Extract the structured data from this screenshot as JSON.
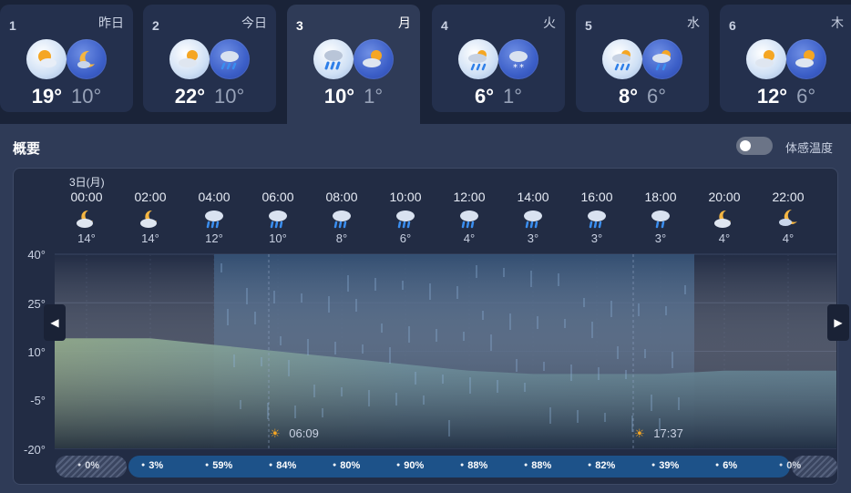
{
  "days": [
    {
      "num": "1",
      "dow": "昨日",
      "hi": "19°",
      "lo": "10°",
      "day_icon": "partly-sunny-icon",
      "night_icon": "partly-cloudy-night-icon"
    },
    {
      "num": "2",
      "dow": "今日",
      "hi": "22°",
      "lo": "10°",
      "day_icon": "partly-cloudy-icon",
      "night_icon": "rain-showers-icon"
    },
    {
      "num": "3",
      "dow": "月",
      "hi": "10°",
      "lo": "1°",
      "day_icon": "heavy-rain-icon",
      "night_icon": "partly-cloudy-icon",
      "selected": true
    },
    {
      "num": "4",
      "dow": "火",
      "hi": "6°",
      "lo": "1°",
      "day_icon": "rain-icon",
      "night_icon": "snow-icon"
    },
    {
      "num": "5",
      "dow": "水",
      "hi": "8°",
      "lo": "6°",
      "day_icon": "rain-icon",
      "night_icon": "rain-showers-icon"
    },
    {
      "num": "6",
      "dow": "木",
      "hi": "12°",
      "lo": "6°",
      "day_icon": "partly-cloudy-icon",
      "night_icon": "partly-cloudy-icon"
    }
  ],
  "overview": {
    "title": "概要",
    "toggle_label": "体感温度"
  },
  "date_label": "3日(月)",
  "hours": [
    {
      "time": "00:00",
      "temp": "14°",
      "icon": "partly-cloudy-night-icon"
    },
    {
      "time": "02:00",
      "temp": "14°",
      "icon": "partly-cloudy-night-icon"
    },
    {
      "time": "04:00",
      "temp": "12°",
      "icon": "rain-icon"
    },
    {
      "time": "06:00",
      "temp": "10°",
      "icon": "rain-icon"
    },
    {
      "time": "08:00",
      "temp": "8°",
      "icon": "rain-icon"
    },
    {
      "time": "10:00",
      "temp": "6°",
      "icon": "rain-icon"
    },
    {
      "time": "12:00",
      "temp": "4°",
      "icon": "rain-icon"
    },
    {
      "time": "14:00",
      "temp": "3°",
      "icon": "rain-icon"
    },
    {
      "time": "16:00",
      "temp": "3°",
      "icon": "rain-icon"
    },
    {
      "time": "18:00",
      "temp": "3°",
      "icon": "rain-showers-icon"
    },
    {
      "time": "20:00",
      "temp": "4°",
      "icon": "partly-cloudy-night-icon"
    },
    {
      "time": "22:00",
      "temp": "4°",
      "icon": "moon-cloud-icon"
    }
  ],
  "y_axis": [
    "40°",
    "25°",
    "10°",
    "-5°",
    "-20°"
  ],
  "sunrise": "06:09",
  "sunset": "17:37",
  "precip": [
    "0%",
    "3%",
    "59%",
    "84%",
    "80%",
    "90%",
    "88%",
    "88%",
    "82%",
    "39%",
    "6%",
    "0%"
  ],
  "chart_data": {
    "type": "area",
    "x": [
      "00:00",
      "02:00",
      "04:00",
      "06:00",
      "08:00",
      "10:00",
      "12:00",
      "14:00",
      "16:00",
      "18:00",
      "20:00",
      "22:00"
    ],
    "series": [
      {
        "values": [
          14,
          14,
          12,
          10,
          8,
          6,
          4,
          3,
          3,
          3,
          4,
          4
        ]
      }
    ],
    "ylim": [
      -20,
      40
    ],
    "yticks": [
      40,
      25,
      10,
      -5,
      -20
    ],
    "rain_band": [
      "04:00",
      "18:00"
    ]
  },
  "colors": {
    "accent": "#1d5289",
    "rain_band": "#3a5a80",
    "temp_fill_warm": "#8fb57c",
    "temp_fill_cool": "#5f9aa6"
  }
}
